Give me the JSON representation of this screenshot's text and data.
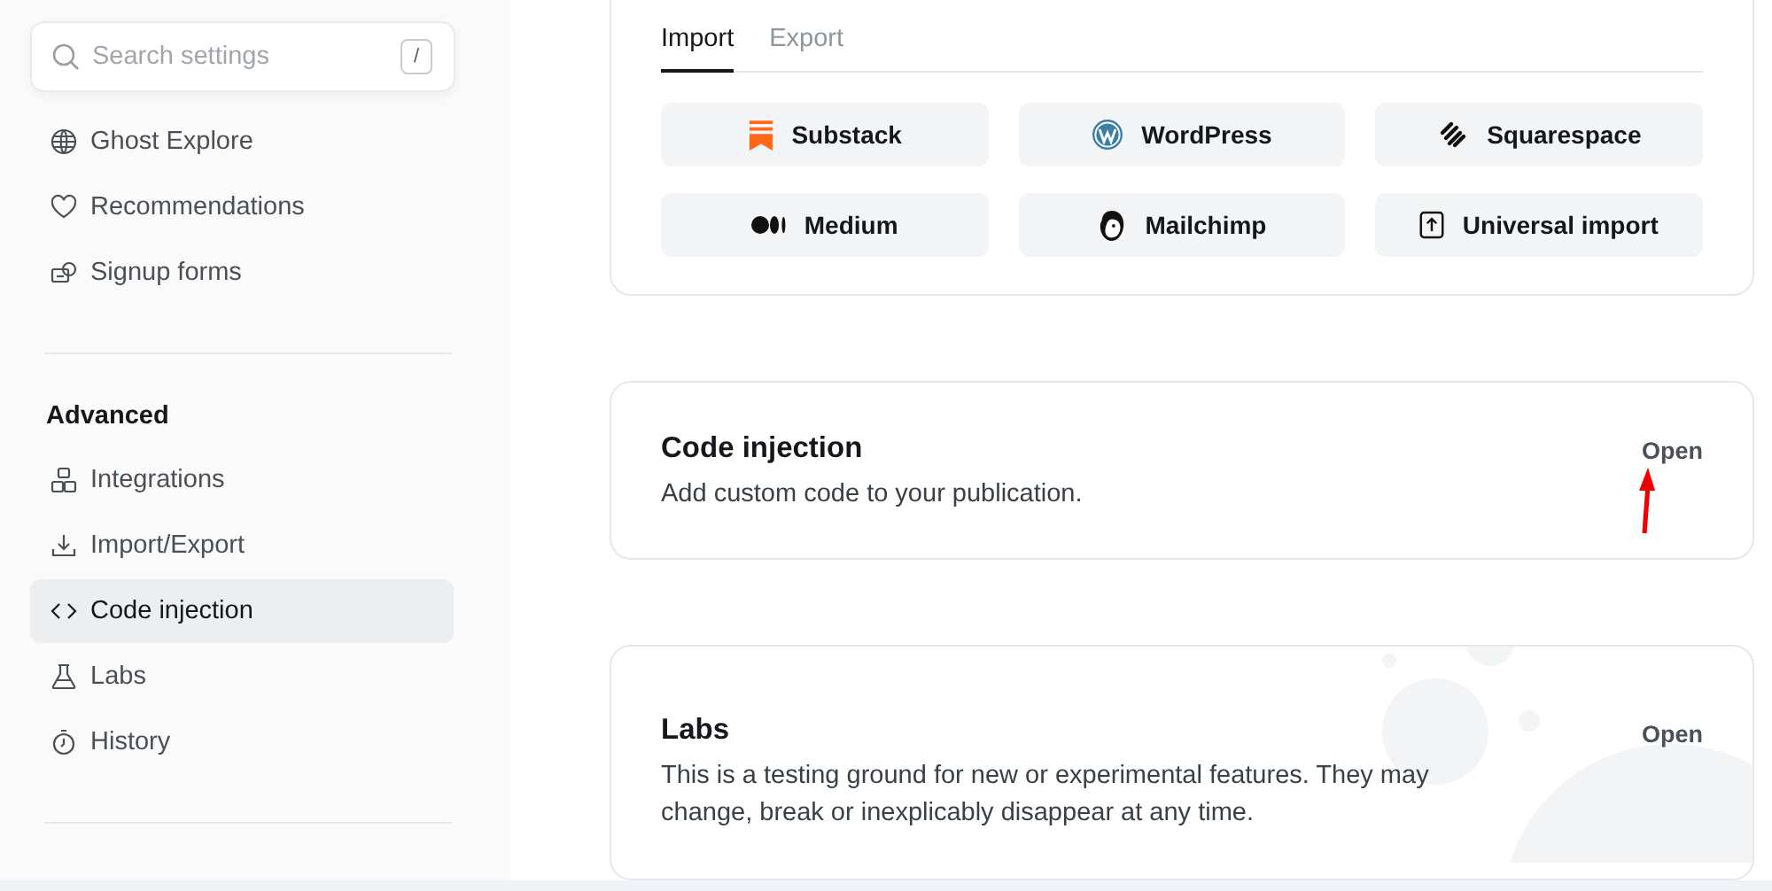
{
  "search": {
    "placeholder": "Search settings",
    "shortcut": "/"
  },
  "sidebar": {
    "groups": [
      {
        "items": [
          {
            "label": "Ghost Explore",
            "selected": false
          },
          {
            "label": "Recommendations",
            "selected": false
          },
          {
            "label": "Signup forms",
            "selected": false
          }
        ]
      },
      {
        "title": "Advanced",
        "items": [
          {
            "label": "Integrations",
            "selected": false
          },
          {
            "label": "Import/Export",
            "selected": false
          },
          {
            "label": "Code injection",
            "selected": true
          },
          {
            "label": "Labs",
            "selected": false
          },
          {
            "label": "History",
            "selected": false
          }
        ]
      }
    ]
  },
  "import_export": {
    "tabs": [
      {
        "label": "Import",
        "selected": true
      },
      {
        "label": "Export",
        "selected": false
      }
    ],
    "sources": [
      {
        "label": "Substack"
      },
      {
        "label": "WordPress"
      },
      {
        "label": "Squarespace"
      },
      {
        "label": "Medium"
      },
      {
        "label": "Mailchimp"
      },
      {
        "label": "Universal import"
      }
    ]
  },
  "sections": [
    {
      "title": "Code injection",
      "description": "Add custom code to your publication.",
      "action": "Open",
      "annotated": true
    },
    {
      "title": "Labs",
      "description": "This is a testing ground for new or experimental features. They may change, break or inexplicably disappear at any time.",
      "action": "Open",
      "annotated": false
    }
  ]
}
